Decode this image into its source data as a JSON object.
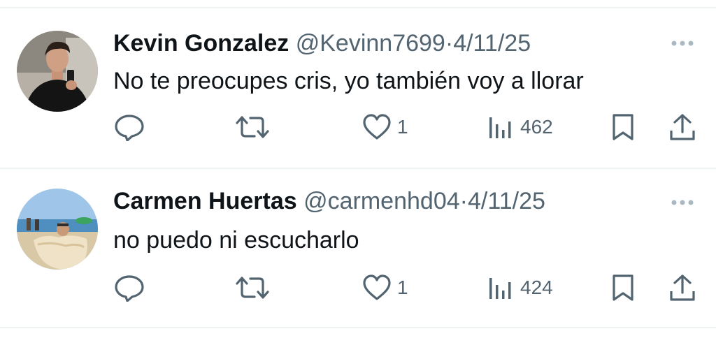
{
  "tweets": [
    {
      "author_name": "Kevin Gonzalez",
      "handle": "@Kevinn7699",
      "separator": "·",
      "date": "4/11/25",
      "text": "No te preocupes cris, yo también voy a llorar",
      "likes": "1",
      "views": "462",
      "avatar": "profile-photo-man-selfie"
    },
    {
      "author_name": "Carmen Huertas",
      "handle": "@carmenhd04",
      "separator": "·",
      "date": "4/11/25",
      "text": "no puedo ni escucharlo",
      "likes": "1",
      "views": "424",
      "avatar": "profile-photo-beach"
    }
  ],
  "icons": [
    "reply-icon",
    "retweet-icon",
    "heart-icon",
    "views-icon",
    "bookmark-icon",
    "share-icon",
    "more-options-icon"
  ],
  "colors": {
    "text": "#0f1419",
    "secondary": "#536471",
    "divider": "#eff3f4"
  }
}
